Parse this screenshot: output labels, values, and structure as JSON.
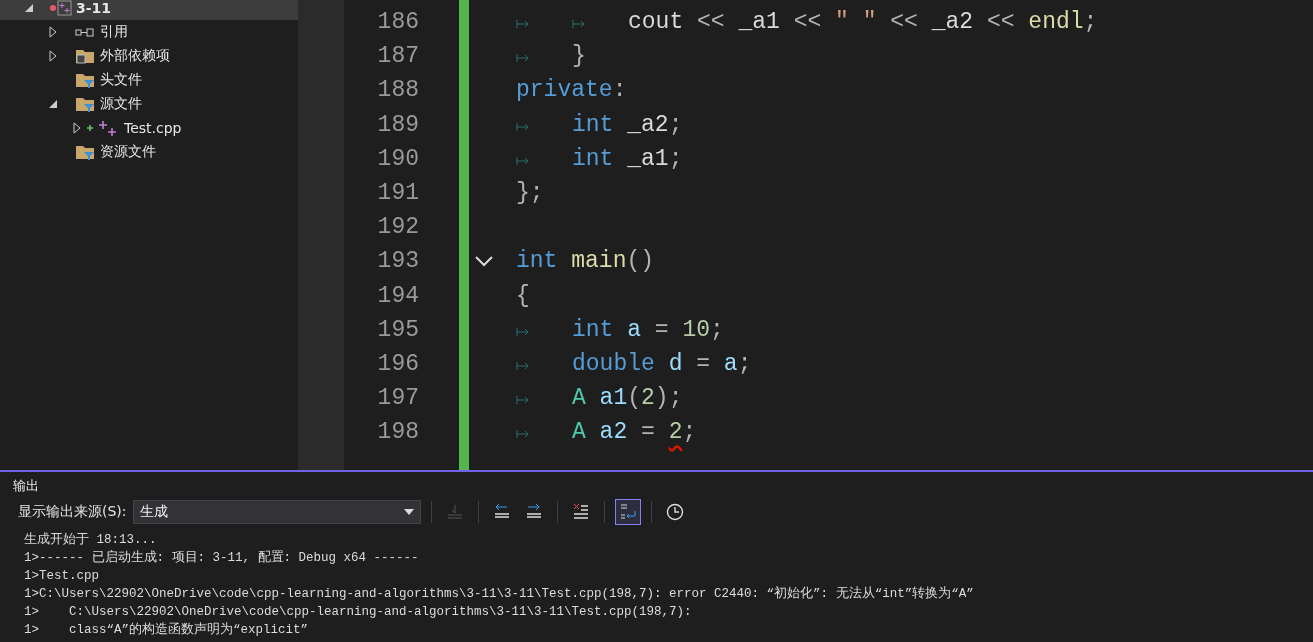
{
  "solution_explorer": {
    "items": [
      {
        "label": "3-11",
        "kind": "project",
        "selected": true,
        "expanded": true,
        "children": [
          {
            "label": "引用",
            "kind": "references",
            "selected": false,
            "expanded": false
          },
          {
            "label": "外部依赖项",
            "kind": "external",
            "selected": false,
            "expanded": false
          },
          {
            "label": "头文件",
            "kind": "filter",
            "selected": false
          },
          {
            "label": "源文件",
            "kind": "filter",
            "selected": false,
            "expanded": true,
            "children": [
              {
                "label": "Test.cpp",
                "kind": "cpp",
                "selected": false,
                "expanded": false,
                "added": true
              }
            ]
          },
          {
            "label": "资源文件",
            "kind": "filter",
            "selected": false
          }
        ]
      }
    ]
  },
  "editor": {
    "lines": [
      {
        "number": "186",
        "tokens": [
          {
            "kind": "tab"
          },
          {
            "kind": "tab"
          },
          {
            "text": "cout",
            "kind": "plain"
          },
          {
            "text": " << ",
            "kind": "punct"
          },
          {
            "text": "_a1",
            "kind": "plain"
          },
          {
            "text": " << ",
            "kind": "punct"
          },
          {
            "text": "\" \"",
            "kind": "string"
          },
          {
            "text": " << ",
            "kind": "punct"
          },
          {
            "text": "_a2",
            "kind": "plain"
          },
          {
            "text": " << ",
            "kind": "punct"
          },
          {
            "text": "endl",
            "kind": "func"
          },
          {
            "text": ";",
            "kind": "punct"
          }
        ]
      },
      {
        "number": "187",
        "tokens": [
          {
            "kind": "tab"
          },
          {
            "text": "}",
            "kind": "punct"
          }
        ]
      },
      {
        "number": "188",
        "tokens": [
          {
            "text": "private",
            "kind": "keyword"
          },
          {
            "text": ":",
            "kind": "punct"
          }
        ]
      },
      {
        "number": "189",
        "tokens": [
          {
            "kind": "tab"
          },
          {
            "text": "int ",
            "kind": "keyword"
          },
          {
            "text": "_a2",
            "kind": "plain"
          },
          {
            "text": ";",
            "kind": "punct"
          }
        ]
      },
      {
        "number": "190",
        "tokens": [
          {
            "kind": "tab"
          },
          {
            "text": "int ",
            "kind": "keyword"
          },
          {
            "text": "_a1",
            "kind": "plain"
          },
          {
            "text": ";",
            "kind": "punct"
          }
        ]
      },
      {
        "number": "191",
        "tokens": [
          {
            "text": "};",
            "kind": "punct"
          }
        ]
      },
      {
        "number": "192"
      },
      {
        "number": "193",
        "fold": true,
        "tokens": [
          {
            "text": "int ",
            "kind": "keyword"
          },
          {
            "text": "main",
            "kind": "func"
          },
          {
            "text": "()",
            "kind": "punct"
          }
        ]
      },
      {
        "number": "194",
        "tokens": [
          {
            "text": "{",
            "kind": "punct"
          }
        ]
      },
      {
        "number": "195",
        "tokens": [
          {
            "kind": "tab"
          },
          {
            "text": "int ",
            "kind": "keyword"
          },
          {
            "text": "a",
            "kind": "variable"
          },
          {
            "text": " = ",
            "kind": "punct"
          },
          {
            "text": "10",
            "kind": "number"
          },
          {
            "text": ";",
            "kind": "punct"
          }
        ]
      },
      {
        "number": "196",
        "tokens": [
          {
            "kind": "tab"
          },
          {
            "text": "double ",
            "kind": "keyword"
          },
          {
            "text": "d",
            "kind": "variable"
          },
          {
            "text": " = ",
            "kind": "punct"
          },
          {
            "text": "a",
            "kind": "variable"
          },
          {
            "text": ";",
            "kind": "punct"
          }
        ]
      },
      {
        "number": "197",
        "tokens": [
          {
            "kind": "tab"
          },
          {
            "text": "A ",
            "kind": "type"
          },
          {
            "text": "a1",
            "kind": "variable"
          },
          {
            "text": "(",
            "kind": "punct"
          },
          {
            "text": "2",
            "kind": "number"
          },
          {
            "text": ");",
            "kind": "punct"
          }
        ]
      },
      {
        "number": "198",
        "tokens": [
          {
            "kind": "tab"
          },
          {
            "text": "A ",
            "kind": "type"
          },
          {
            "text": "a2",
            "kind": "variable"
          },
          {
            "text": " = ",
            "kind": "punct"
          },
          {
            "text": "2",
            "kind": "number",
            "error": true
          },
          {
            "text": ";",
            "kind": "punct"
          }
        ]
      }
    ]
  },
  "output": {
    "title": "输出",
    "source_label": "显示输出来源(S):",
    "source_value": "生成",
    "toolbar_buttons": [
      {
        "kind": "goto",
        "disabled": true,
        "on": false
      },
      {
        "kind": "prev",
        "disabled": false,
        "on": false
      },
      {
        "kind": "next",
        "disabled": false,
        "on": false
      },
      {
        "kind": "clear",
        "disabled": false,
        "on": false
      },
      {
        "kind": "wrap",
        "disabled": false,
        "on": true
      },
      {
        "kind": "clock",
        "disabled": false,
        "on": false
      }
    ],
    "lines": [
      "生成开始于 18:13...",
      "1>------ 已启动生成: 项目: 3-11, 配置: Debug x64 ------",
      "1>Test.cpp",
      "1>C:\\Users\\22902\\OneDrive\\code\\cpp-learning-and-algorithms\\3-11\\3-11\\Test.cpp(198,7): error C2440: “初始化”: 无法从“int”转换为“A”",
      "1>    C:\\Users\\22902\\OneDrive\\code\\cpp-learning-and-algorithms\\3-11\\3-11\\Test.cpp(198,7):",
      "1>    class“A”的构造函数声明为“explicit”"
    ]
  }
}
